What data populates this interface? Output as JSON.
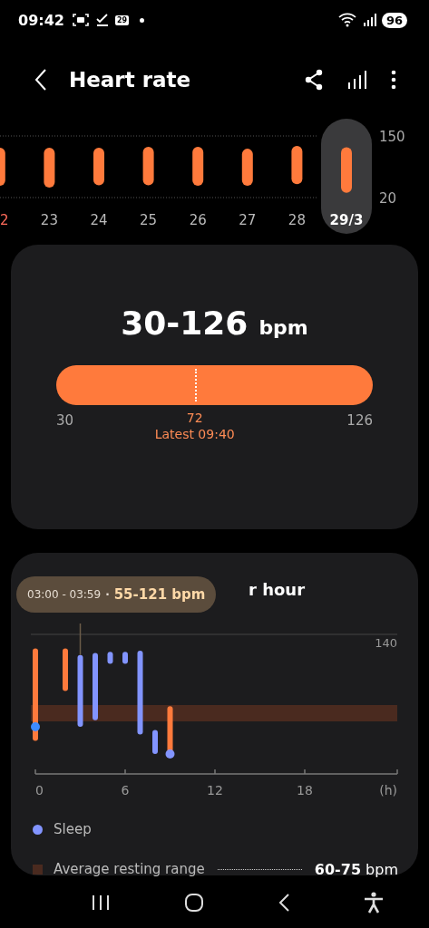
{
  "status_bar": {
    "time": "09:42",
    "calendar_day": "29",
    "battery": "96"
  },
  "header": {
    "title": "Heart rate"
  },
  "week_chart": {
    "days": [
      {
        "label": "2",
        "selected": false,
        "sunday": true
      },
      {
        "label": "23",
        "selected": false,
        "sunday": false
      },
      {
        "label": "24",
        "selected": false,
        "sunday": false
      },
      {
        "label": "25",
        "selected": false,
        "sunday": false
      },
      {
        "label": "26",
        "selected": false,
        "sunday": false
      },
      {
        "label": "27",
        "selected": false,
        "sunday": false
      },
      {
        "label": "28",
        "selected": false,
        "sunday": false
      },
      {
        "label": "29/3",
        "selected": true,
        "sunday": false
      }
    ],
    "y_labels": [
      "150",
      "20"
    ]
  },
  "summary": {
    "range": "30-126",
    "unit": "bpm",
    "min_label": "30",
    "max_label": "126",
    "latest_value": "72",
    "latest_label": "Latest 09:40",
    "level": 0.4375
  },
  "hourly": {
    "title": "r hour",
    "tooltip": {
      "time": "03:00 - 03:59",
      "separator": "·",
      "value": "55-121 bpm"
    },
    "y_label": "140",
    "x_labels": [
      "0",
      "6",
      "12",
      "18",
      "(h)"
    ],
    "hours": [
      {
        "kind": "awake"
      },
      {
        "kind": "none"
      },
      {
        "kind": "awake"
      },
      {
        "kind": "sleep"
      },
      {
        "kind": "sleep"
      },
      {
        "kind": "sleep"
      },
      {
        "kind": "sleep"
      },
      {
        "kind": "sleep"
      },
      {
        "kind": "sleep"
      },
      {
        "kind": "awake"
      }
    ],
    "legend": [
      {
        "kind": "dot",
        "label": "Sleep",
        "color": "#8294ff"
      },
      {
        "kind": "square",
        "label": "Average resting range",
        "color": "#4a2a1f",
        "value": "**60-75** bpm"
      }
    ]
  }
}
